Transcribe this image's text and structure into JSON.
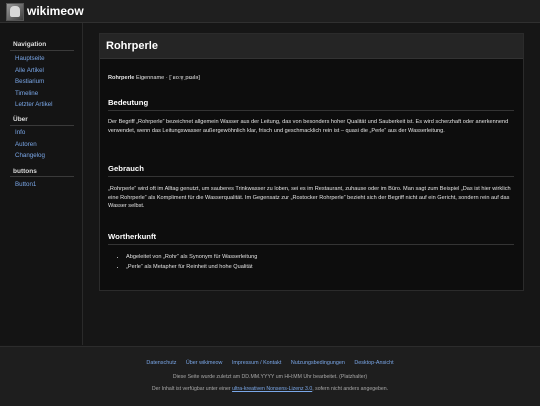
{
  "header": {
    "site_name": "wikimeow",
    "logo_icon": "cat-logo-icon"
  },
  "sidebar": {
    "sections": [
      {
        "heading": "Navigation",
        "items": [
          "Hauptseite",
          "Alle Artikel",
          "Bestiarium",
          "Timeline",
          "Letzter Artikel"
        ]
      },
      {
        "heading": "Über",
        "items": [
          "Info",
          "Autoren",
          "Changelog"
        ]
      },
      {
        "heading": "buttons",
        "items": [
          "Button1"
        ]
      }
    ]
  },
  "article": {
    "title": "Rohrperle",
    "lemma": "Rohrperle",
    "lemma_rest": " Eigenname · [ˈʁoːɐ̯ˌpɛʁlə]",
    "sections": [
      {
        "heading": "Bedeutung",
        "text": "Der Begriff „Rohrperle“ bezeichnet allgemein Wasser aus der Leitung, das von besonders hoher Qualität und Sauberkeit ist. Es wird scherzhaft oder anerkennend verwendet, wenn das Leitungswasser außergewöhnlich klar, frisch und geschmacklich rein ist – quasi die „Perle“ aus der Wasserleitung."
      },
      {
        "heading": "Gebrauch",
        "text": "„Rohrperle“ wird oft im Alltag genutzt, um sauberes Trinkwasser zu loben, sei es im Restaurant, zuhause oder im Büro. Man sagt zum Beispiel „Das ist hier wirklich eine Rohrperle“ als Kompliment für die Wasserqualität. Im Gegensatz zur „Rostocker Rohrperle“ bezieht sich der Begriff nicht auf ein Gericht, sondern rein auf das Wasser selbst."
      },
      {
        "heading": "Wortherkunft",
        "bullets": [
          "Abgeleitet von „Rohr“ als Synonym für Wasserleitung",
          "„Perle“ als Metapher für Reinheit und hohe Qualität"
        ]
      }
    ]
  },
  "footer": {
    "links": [
      "Datenschutz",
      "Über wikimeow",
      "Impressum / Kontakt",
      "Nutzungsbedingungen",
      "Desktop-Ansicht"
    ],
    "edited": "Diese Seite wurde zuletzt am DD.MM.YYYY um HH:MM Uhr bearbeitet. (Platzhalter)",
    "license_pre": "Der Inhalt ist verfügbar unter einer ",
    "license_link": "ultra-kreativen Nonsens-Lizenz 3.0",
    "license_post": ", sofern nicht anders angegeben."
  }
}
